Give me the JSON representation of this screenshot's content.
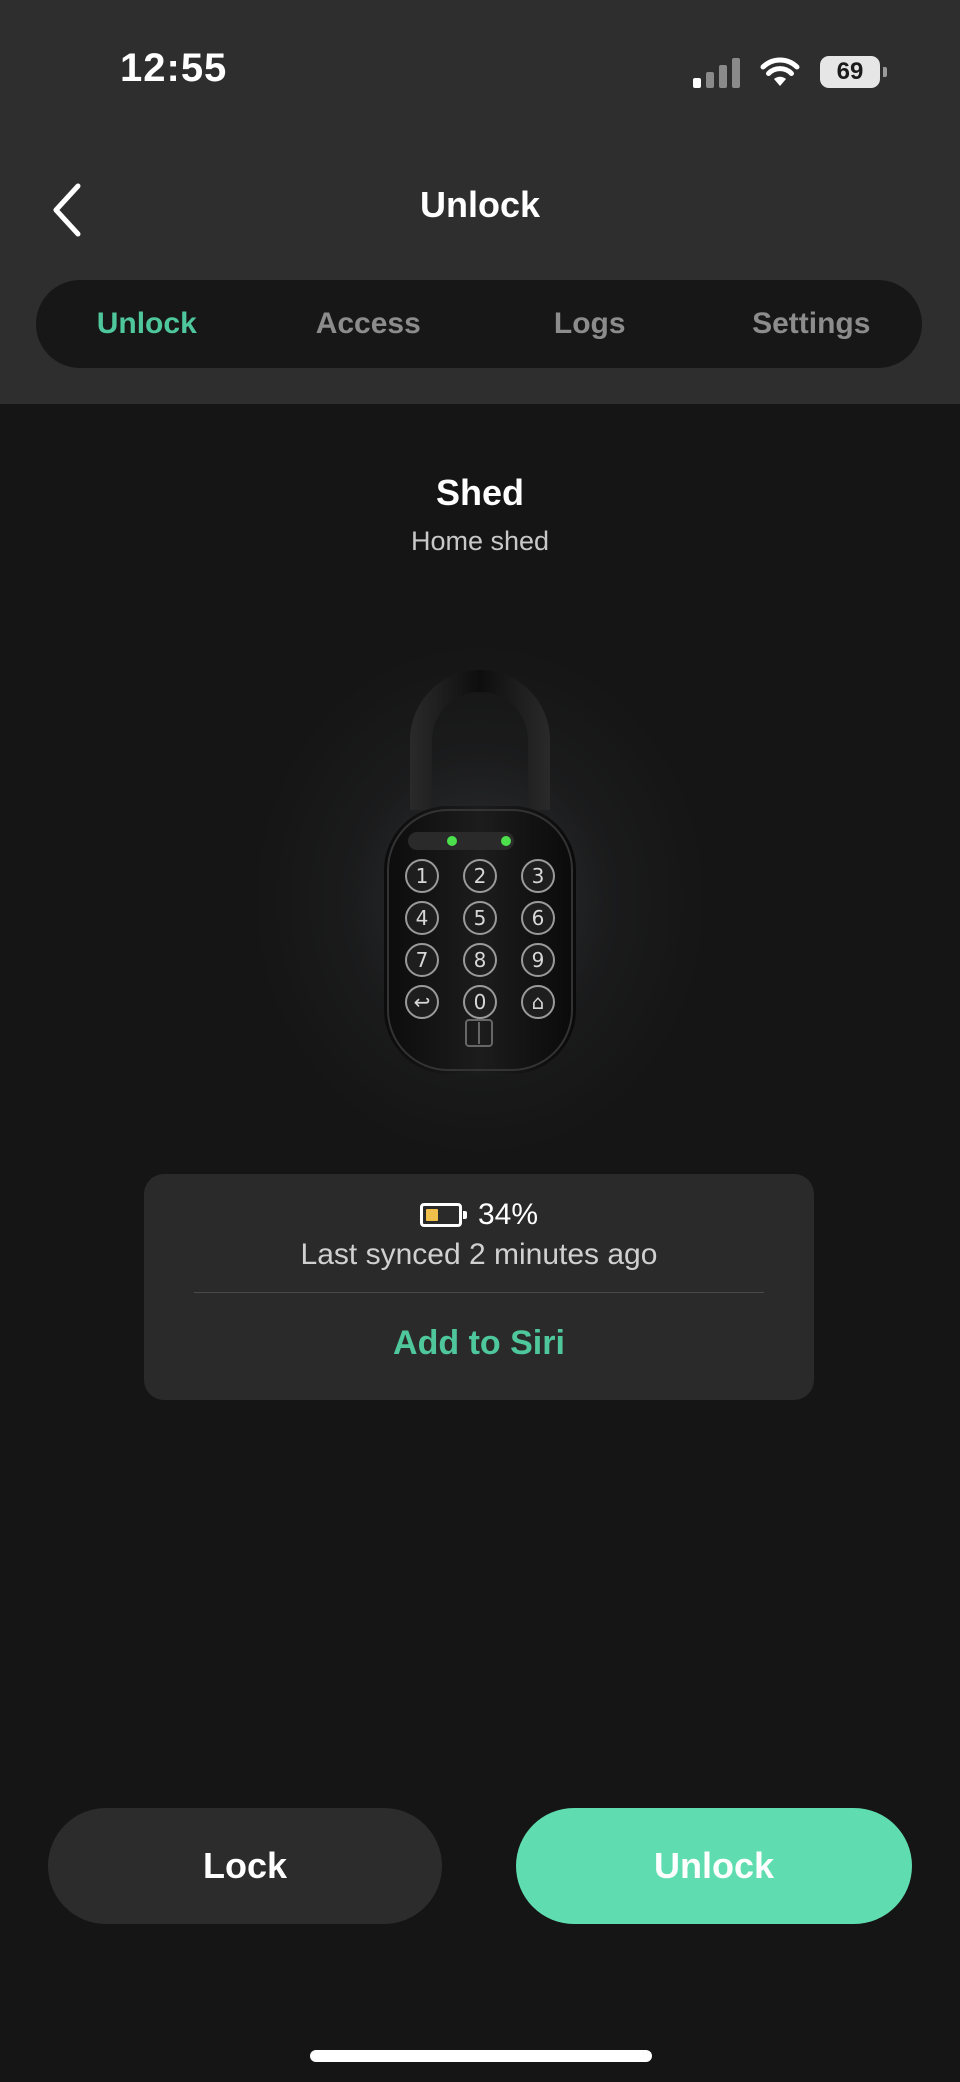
{
  "status_bar": {
    "time": "12:55",
    "battery_level": "69",
    "signal_bars_active": 1,
    "signal_bars_total": 4,
    "wifi_icon": "wifi-icon"
  },
  "header": {
    "title": "Unlock",
    "back_icon": "chevron-left-icon"
  },
  "tabs": [
    {
      "label": "Unlock",
      "active": true
    },
    {
      "label": "Access",
      "active": false
    },
    {
      "label": "Logs",
      "active": false
    },
    {
      "label": "Settings",
      "active": false
    }
  ],
  "lock": {
    "name": "Shed",
    "description": "Home shed",
    "image": "keypad-padlock-image",
    "keypad_keys": [
      "1",
      "2",
      "3",
      "4",
      "5",
      "6",
      "7",
      "8",
      "9",
      "0"
    ]
  },
  "info_card": {
    "battery_percent": "34%",
    "battery_fill": 0.34,
    "last_synced": "Last synced  2 minutes ago",
    "siri_label": "Add to Siri"
  },
  "actions": {
    "lock_label": "Lock",
    "unlock_label": "Unlock"
  },
  "colors": {
    "accent": "#4fc79c",
    "unlock_button": "#5fdcb0",
    "background": "#151515",
    "header_bg": "#2e2e2e",
    "battery_fill": "#f1c04a"
  }
}
